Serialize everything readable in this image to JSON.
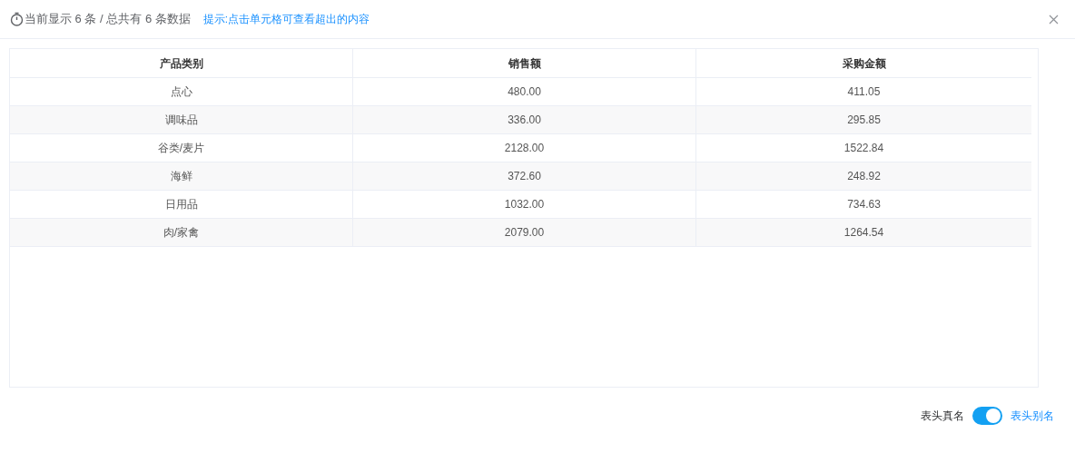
{
  "header": {
    "summary": "当前显示 6 条 / 总共有 6 条数据",
    "hint": "提示:点击单元格可查看超出的内容"
  },
  "table": {
    "columns": [
      "产品类别",
      "销售额",
      "采购金额"
    ],
    "rows": [
      [
        "点心",
        "480.00",
        "411.05"
      ],
      [
        "调味品",
        "336.00",
        "295.85"
      ],
      [
        "谷类/麦片",
        "2128.00",
        "1522.84"
      ],
      [
        "海鲜",
        "372.60",
        "248.92"
      ],
      [
        "日用品",
        "1032.00",
        "734.63"
      ],
      [
        "肉/家禽",
        "2079.00",
        "1264.54"
      ]
    ]
  },
  "footer": {
    "off_label": "表头真名",
    "on_label": "表头别名",
    "toggle": {
      "on": true
    }
  }
}
